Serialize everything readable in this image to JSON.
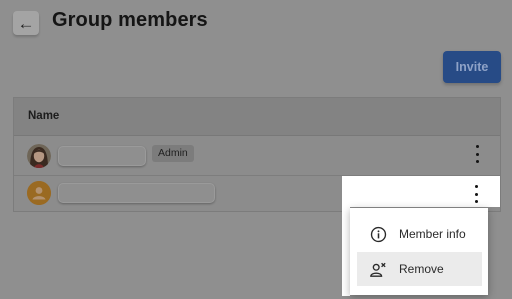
{
  "header": {
    "back_glyph": "←",
    "title": "Group members"
  },
  "toolbar": {
    "invite_label": "Invite"
  },
  "table": {
    "columns": [
      "Name"
    ],
    "rows": [
      {
        "name": "",
        "role": "Admin",
        "avatar": "woman-avatar-icon"
      },
      {
        "name": "",
        "role": "",
        "avatar": "default-user-avatar-icon"
      }
    ]
  },
  "row_menu": {
    "items": [
      {
        "label": "Member info",
        "icon": "info-icon"
      },
      {
        "label": "Remove",
        "icon": "remove-user-icon"
      }
    ]
  },
  "colors": {
    "overlay": "#8f8f8f",
    "invite_button": "#274b86",
    "menu_background": "#ffffff",
    "menu_hover": "#ebebeb",
    "default_avatar": "#9a6a22"
  }
}
